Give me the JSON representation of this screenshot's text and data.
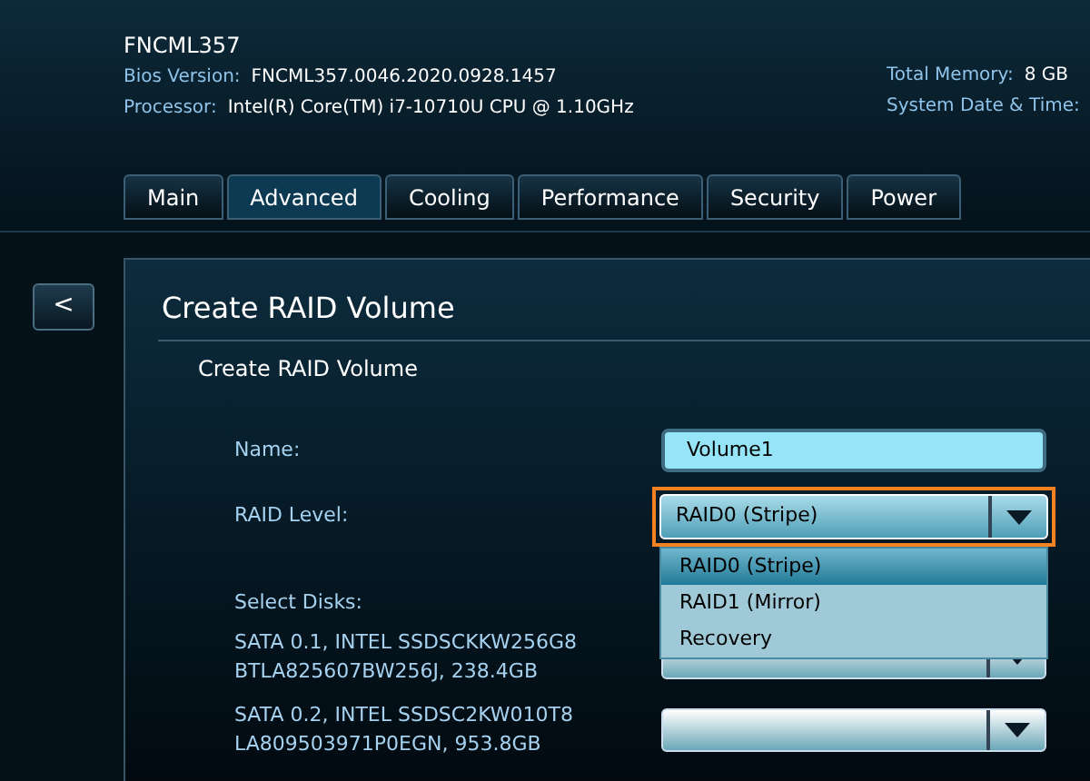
{
  "header": {
    "model": "FNCML357",
    "info": [
      {
        "label": "Bios Version:",
        "value": "FNCML357.0046.2020.0928.1457"
      },
      {
        "label": "Processor:",
        "value": "Intel(R) Core(TM) i7-10710U CPU @ 1.10GHz"
      }
    ],
    "right_info": [
      {
        "label": "Total Memory:",
        "value": "8 GB"
      },
      {
        "label": "System Date & Time:"
      }
    ]
  },
  "tabs": [
    {
      "label": "Main",
      "selected": false
    },
    {
      "label": "Advanced",
      "selected": true
    },
    {
      "label": "Cooling",
      "selected": false
    },
    {
      "label": "Performance",
      "selected": false
    },
    {
      "label": "Security",
      "selected": false
    },
    {
      "label": "Power",
      "selected": false
    }
  ],
  "back_button": "<",
  "panel": {
    "title": "Create RAID Volume",
    "subtitle": "Create RAID Volume",
    "name_label": "Name:",
    "name_value": "Volume1",
    "raid_label": "RAID Level:",
    "raid_value": "RAID0 (Stripe)",
    "highlighted": true,
    "options": [
      {
        "label": "RAID0 (Stripe)",
        "selected": true
      },
      {
        "label": "RAID1 (Mirror)",
        "selected": false
      },
      {
        "label": "Recovery",
        "selected": false
      }
    ],
    "disks_label": "Select Disks:",
    "disks": [
      {
        "line1": "SATA 0.1, INTEL SSDSCKKW256G8",
        "line2": "BTLA825607BW256J, 238.4GB"
      },
      {
        "line1": "SATA 0.2, INTEL SSDSC2KW010T8",
        "line2": "LA809503971P0EGN, 953.8GB"
      }
    ]
  }
}
